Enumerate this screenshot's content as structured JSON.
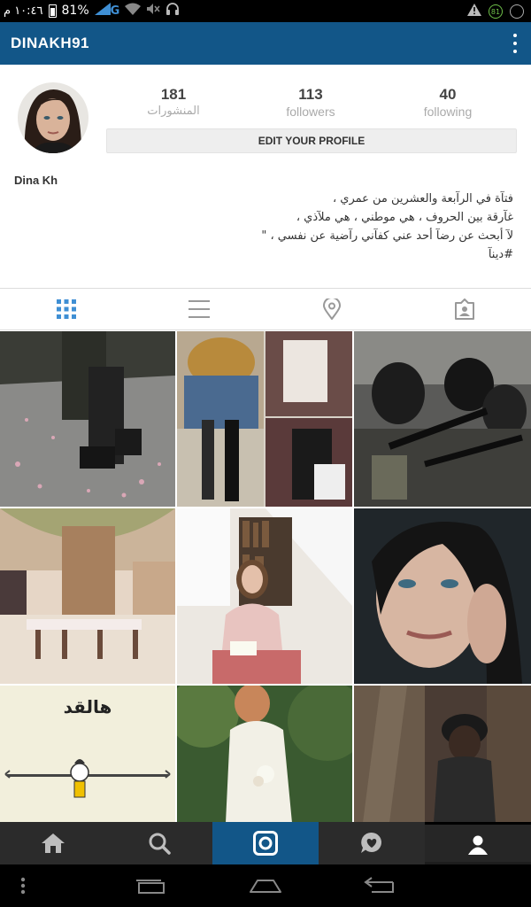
{
  "status_bar": {
    "time": "١٠:٤٦ م",
    "battery": "81%",
    "network": "G",
    "badge": "81"
  },
  "app_bar": {
    "username": "DINAKH91"
  },
  "profile": {
    "posts_count": "181",
    "posts_label": "المنشورات",
    "followers_count": "113",
    "followers_label": "followers",
    "following_count": "40",
    "following_label": "following",
    "edit_button": "EDIT YOUR PROFILE",
    "name": "Dina Kh",
    "bio_lines": [
      "فتآة في الرآبعة والعشرين من عمري ،",
      "غآرقة بين الحروف ، هي موطني ، هي ملآذي ،",
      "لآ أبحث عن رضآ أحد عني كفآني رآضية عن نفسي ، \"",
      "#دينآ"
    ]
  },
  "grid": {
    "cell7_text": "هالقد"
  },
  "tabs": [
    "grid-view",
    "list-view",
    "photo-map",
    "tagged-photos"
  ],
  "colors": {
    "brand": "#125688",
    "tab_active": "#3f8fd4",
    "tab_inactive": "#999999"
  }
}
